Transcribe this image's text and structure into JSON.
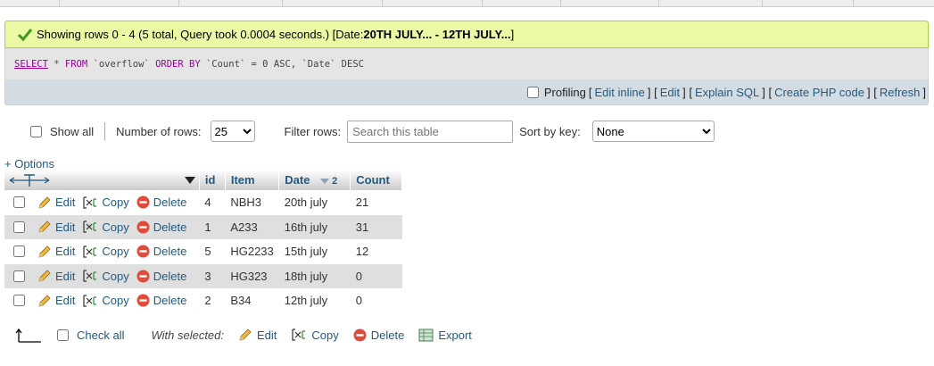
{
  "success": {
    "text_prefix": "Showing rows 0 - 4 (5 total, Query took 0.0004 seconds.) [Date: ",
    "date_range": "20TH JULY... - 12TH JULY...",
    "text_suffix": "]"
  },
  "sql": {
    "select": "SELECT",
    "star": " * ",
    "from": "FROM",
    "table": " `overflow` ",
    "orderby": "ORDER BY",
    "rest": " `Count` = 0 ASC, `Date` DESC"
  },
  "tools": {
    "profiling": "Profiling",
    "edit_inline": "Edit inline",
    "edit": "Edit",
    "explain": "Explain SQL",
    "create_php": "Create PHP code",
    "refresh": "Refresh"
  },
  "nav": {
    "show_all": "Show all",
    "rows_label": "Number of rows:",
    "rows_value": "25",
    "filter_label": "Filter rows:",
    "filter_placeholder": "Search this table",
    "sort_label": "Sort by key:",
    "sort_value": "None"
  },
  "options_link": "+ Options",
  "table": {
    "columns": [
      "id",
      "Item",
      "Date",
      "Count"
    ],
    "date_sort_index": "2",
    "action_labels": {
      "edit": "Edit",
      "copy": "Copy",
      "delete": "Delete"
    },
    "rows": [
      {
        "id": "4",
        "item": "NBH3",
        "date": "20th july",
        "count": "21"
      },
      {
        "id": "1",
        "item": "A233",
        "date": "16th july",
        "count": "31"
      },
      {
        "id": "5",
        "item": "HG2233",
        "date": "15th july",
        "count": "12"
      },
      {
        "id": "3",
        "item": "HG323",
        "date": "18th july",
        "count": "0"
      },
      {
        "id": "2",
        "item": "B34",
        "date": "12th july",
        "count": "0"
      }
    ]
  },
  "bottom": {
    "check_all": "Check all",
    "with_selected": "With selected:",
    "edit": "Edit",
    "copy": "Copy",
    "delete": "Delete",
    "export": "Export"
  },
  "colors": {
    "link": "#235a81",
    "success_bg": "#ebf8a4",
    "toolbar_bg": "#d3dce3",
    "row_even": "#dfdfdf",
    "delete_red": "#e04b3a"
  }
}
